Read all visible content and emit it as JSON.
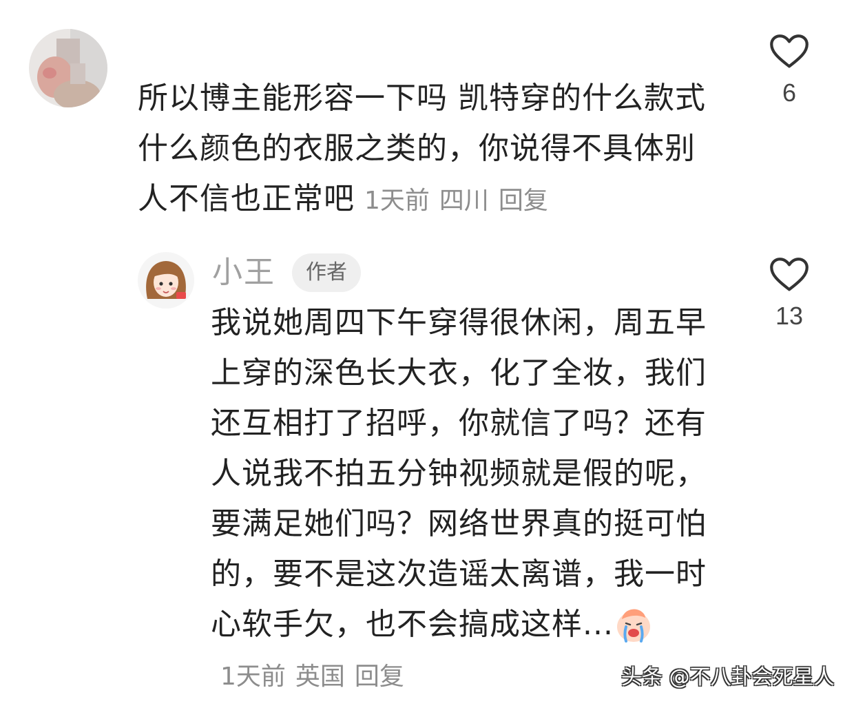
{
  "comments": [
    {
      "text": "所以博主能形容一下吗 凯特穿的什么款式什么颜色的衣服之类的，你说得不具体别人不信也正常吧",
      "time": "1天前",
      "location": "四川",
      "reply_label": "回复",
      "likes": "6",
      "avatar_icon": "user-avatar-blurred"
    },
    {
      "author": "小王",
      "badge": "作者",
      "text": "我说她周四下午穿得很休闲，周五早上穿的深色长大衣，化了全妆，我们还互相打了招呼，你就信了吗？还有人说我不拍五分钟视频就是假的呢，要满足她们吗？网络世界真的挺可怕的，要不是这次造谣太离谱，我一时心软手欠，也不会搞成这样...",
      "emoji_icon": "crying-emoji-icon",
      "time": "1天前",
      "location": "英国",
      "reply_label": "回复",
      "likes": "13",
      "avatar_icon": "cartoon-girl-avatar"
    }
  ],
  "watermark": "头条 @不八卦会死星人",
  "icons": {
    "like": "heart-outline-icon"
  }
}
